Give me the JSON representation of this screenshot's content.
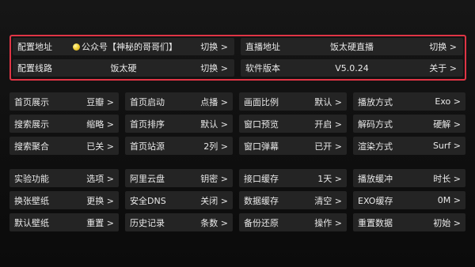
{
  "top": {
    "rows": [
      [
        {
          "label": "配置地址",
          "value": "公众号【神秘的哥哥们】",
          "action": "切换 >",
          "icon": "yellow-coin-icon"
        },
        {
          "label": "直播地址",
          "value": "饭太硬直播",
          "action": "切换 >"
        }
      ],
      [
        {
          "label": "配置线路",
          "value": "饭太硬",
          "action": "切换 >"
        },
        {
          "label": "软件版本",
          "value": "V5.0.24",
          "action": "关于 >"
        }
      ]
    ]
  },
  "grid1": [
    [
      {
        "label": "首页展示",
        "value": "豆瓣 >"
      },
      {
        "label": "首页启动",
        "value": "点播 >"
      },
      {
        "label": "画面比例",
        "value": "默认 >"
      },
      {
        "label": "播放方式",
        "value": "Exo >"
      }
    ],
    [
      {
        "label": "搜索展示",
        "value": "缩略 >"
      },
      {
        "label": "首页排序",
        "value": "默认 >"
      },
      {
        "label": "窗口预览",
        "value": "开启 >"
      },
      {
        "label": "解码方式",
        "value": "硬解 >"
      }
    ],
    [
      {
        "label": "搜索聚合",
        "value": "已关 >"
      },
      {
        "label": "首页站源",
        "value": "2列 >"
      },
      {
        "label": "窗口弹幕",
        "value": "已开 >"
      },
      {
        "label": "渲染方式",
        "value": "Surf >"
      }
    ]
  ],
  "grid2": [
    [
      {
        "label": "实验功能",
        "value": "选项 >"
      },
      {
        "label": "阿里云盘",
        "value": "钥密 >"
      },
      {
        "label": "接口缓存",
        "value": "1天 >"
      },
      {
        "label": "播放缓冲",
        "value": "时长 >"
      }
    ],
    [
      {
        "label": "换张壁纸",
        "value": "更换 >"
      },
      {
        "label": "安全DNS",
        "value": "关闭 >"
      },
      {
        "label": "数据缓存",
        "value": "清空 >"
      },
      {
        "label": "EXO缓存",
        "value": "0M >"
      }
    ],
    [
      {
        "label": "默认壁纸",
        "value": "重置 >"
      },
      {
        "label": "历史记录",
        "value": "条数 >"
      },
      {
        "label": "备份还原",
        "value": "操作 >"
      },
      {
        "label": "重置数据",
        "value": "初始 >"
      }
    ]
  ]
}
